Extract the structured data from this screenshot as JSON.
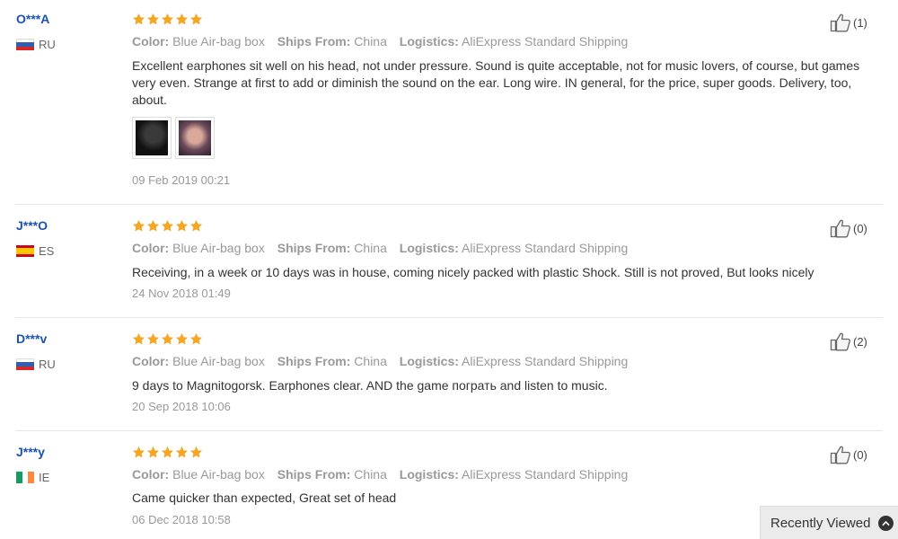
{
  "labels": {
    "color": "Color:",
    "ships_from": "Ships From:",
    "logistics": "Logistics:"
  },
  "reviews": [
    {
      "user": "O***A",
      "country_code": "RU",
      "stars": 5,
      "color": "Blue Air-bag box",
      "ships_from": "China",
      "logistics": "AliExpress Standard Shipping",
      "text": "Excellent earphones sit well on his head, not under pressure. Sound is quite acceptable, not for music lovers, of course, but games very even. Strange at first to add or diminish the sound on the ear. Long wire. IN general, for the price, super goods. Delivery, too, about.",
      "date": "09 Feb 2019 00:21",
      "helpful": "(1)"
    },
    {
      "user": "J***O",
      "country_code": "ES",
      "stars": 5,
      "color": "Blue Air-bag box",
      "ships_from": "China",
      "logistics": "AliExpress Standard Shipping",
      "text": "Receiving, in a week or 10 days was in house, coming nicely packed with plastic Shock. Still is not proved, But looks nicely",
      "date": "24 Nov 2018 01:49",
      "helpful": "(0)"
    },
    {
      "user": "D***v",
      "country_code": "RU",
      "stars": 5,
      "color": "Blue Air-bag box",
      "ships_from": "China",
      "logistics": "AliExpress Standard Shipping",
      "text": "9 days to Magnitogorsk. Earphones clear. AND the game пограть and listen to music.",
      "date": "20 Sep 2018 10:06",
      "helpful": "(2)"
    },
    {
      "user": "J***y",
      "country_code": "IE",
      "stars": 5,
      "color": "Blue Air-bag box",
      "ships_from": "China",
      "logistics": "AliExpress Standard Shipping",
      "text": "Came quicker than expected, Great set of head",
      "date": "06 Dec 2018 10:58",
      "helpful": "(0)"
    }
  ],
  "recently_viewed": "Recently Viewed",
  "colors": {
    "star": "#f5a623",
    "user_link": "#1a53b0",
    "muted": "#999999"
  },
  "icons": {
    "helpful": "thumbs-up-icon",
    "recent": "chevron-up-icon"
  }
}
